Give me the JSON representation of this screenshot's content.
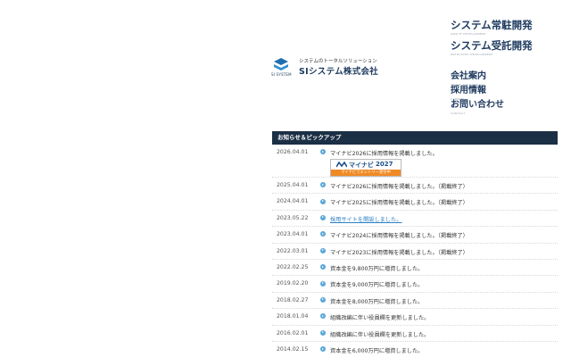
{
  "logo": {
    "tagline": "システムのトータルソリューション",
    "company": "SIシステム株式会社",
    "mark_text": "SI SYSTEM"
  },
  "nav": [
    {
      "label": "システム常駐開発",
      "sub": "ONSITE DEVELOPMENT"
    },
    {
      "label": "システム受託開発",
      "sub": "ENTRUSTED DEVELOPMENT"
    },
    {
      "label": "会社案内",
      "sub": "ABOUT THE COMPANY"
    },
    {
      "label": "採用情報",
      "sub": "CAREERS"
    },
    {
      "label": "お問い合わせ",
      "sub": "CONTACT"
    }
  ],
  "news": {
    "header": "お知らせ＆ピックアップ",
    "items": [
      {
        "date": "2026.04.01",
        "text": "マイナビ2026に採用情報を掲載しました。"
      },
      {
        "date": "2025.04.01",
        "text": "マイナビ2026に採用情報を掲載しました。（掲載終了）"
      },
      {
        "date": "2024.04.01",
        "text": "マイナビ2025に採用情報を掲載しました。（掲載終了）"
      },
      {
        "date": "2023.05.22",
        "text": "採用サイトを開設しました。"
      },
      {
        "date": "2023.04.01",
        "text": "マイナビ2024に採用情報を掲載しました。（掲載終了）"
      },
      {
        "date": "2022.03.01",
        "text": "マイナビ2023に採用情報を掲載しました。（掲載終了）"
      },
      {
        "date": "2022.02.25",
        "text": "資本金を9,800万円に増資しました。"
      },
      {
        "date": "2019.02.20",
        "text": "資本金を9,000万円に増資しました。"
      },
      {
        "date": "2018.02.27",
        "text": "資本金を8,000万円に増資しました。"
      },
      {
        "date": "2018.01.04",
        "text": "組織改編に伴い役員欄を更新しました。"
      },
      {
        "date": "2016.02.01",
        "text": "組織改編に伴い役員欄を更新しました。"
      },
      {
        "date": "2014.02.15",
        "text": "資本金を6,000万円に増資しました。"
      }
    ]
  },
  "banner": {
    "name": "マイナビ",
    "year": "2027",
    "cta": "マイナビでエントリー受付中"
  },
  "colors": {
    "navy": "#1b2f45",
    "brand": "#1e3a5f",
    "link": "#2a7fc4",
    "orange": "#f08a24"
  }
}
